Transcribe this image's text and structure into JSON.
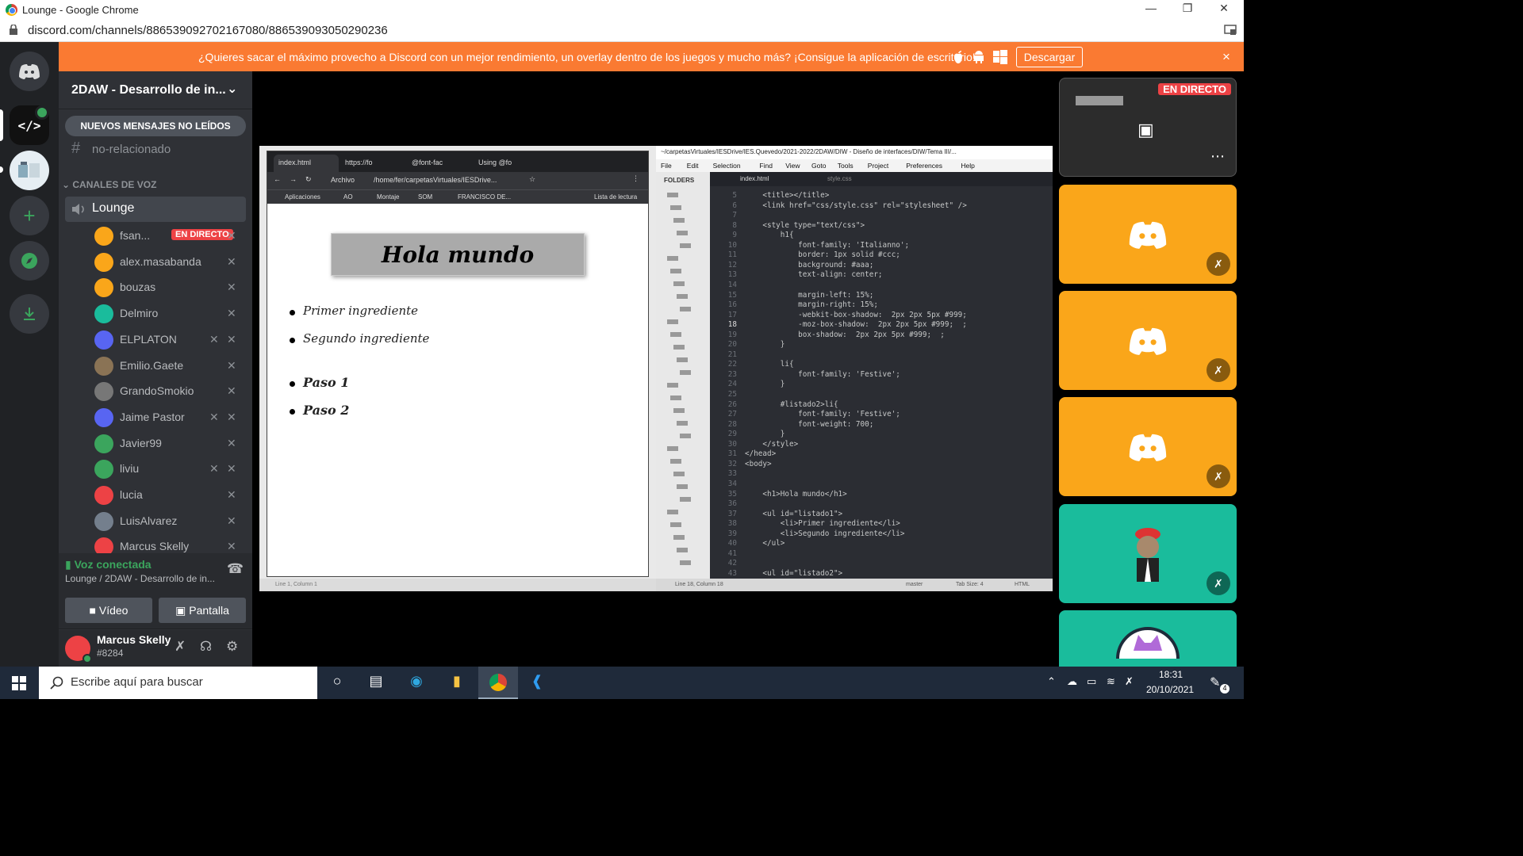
{
  "window": {
    "title": "Lounge - Google Chrome",
    "url": "discord.com/channels/886539092702167080/886539093050290236"
  },
  "banner": {
    "message": "¿Quieres sacar el máximo provecho a Discord con un mejor rendimiento, un overlay dentro de los juegos y mucho más? ¡Consigue la aplicación de escritorio!",
    "download_label": "Descargar",
    "close": "×"
  },
  "server": {
    "name": "2DAW - Desarrollo de in...",
    "unread_label": "NUEVOS MENSAJES NO LEÍDOS"
  },
  "channels": {
    "text_channel": "no-relacionado",
    "voice_category": "CANALES DE VOZ",
    "voice_channel": "Lounge"
  },
  "voice_users": [
    {
      "name": "fsan...",
      "live": "EN DIRECTO",
      "color": "#faa61a"
    },
    {
      "name": "alex.masabanda",
      "color": "#faa61a"
    },
    {
      "name": "bouzas",
      "color": "#faa61a"
    },
    {
      "name": "Delmiro",
      "color": "#1abc9c"
    },
    {
      "name": "ELPLATON",
      "color": "#5865f2"
    },
    {
      "name": "Emilio.Gaete",
      "color": "#8a7355"
    },
    {
      "name": "GrandoSmokio",
      "color": "#777"
    },
    {
      "name": "Jaime Pastor",
      "color": "#5865f2"
    },
    {
      "name": "Javier99",
      "color": "#3ba55d"
    },
    {
      "name": "liviu",
      "color": "#3ba55d"
    },
    {
      "name": "lucia",
      "color": "#ed4245"
    },
    {
      "name": "LuisAlvarez",
      "color": "#747f8d"
    },
    {
      "name": "Marcus Skelly",
      "color": "#ed4245"
    }
  ],
  "voice_panel": {
    "status": "Voz conectada",
    "location": "Lounge / 2DAW - Desarrollo de in...",
    "video_label": "Vídeo",
    "screen_label": "Pantalla"
  },
  "user": {
    "name": "Marcus Skelly",
    "tag": "#8284"
  },
  "browser": {
    "tabs": [
      "index.html",
      "https://fo",
      "@font-fac",
      "Using @fo"
    ],
    "address": "/home/fer/carpetasVirtuales/IESDrive...",
    "address_prefix": "Archivo",
    "bookmarks": [
      "Aplicaciones",
      "AO",
      "Montaje",
      "SOM",
      "FRANCISCO DE...",
      "Lista de lectura"
    ],
    "page": {
      "heading": "Hola mundo",
      "list1": [
        "Primer ingrediente",
        "Segundo ingrediente"
      ],
      "list2": [
        "Paso 1",
        "Paso 2"
      ]
    }
  },
  "editor": {
    "title": "~/carpetasVirtuales/IESDrive/IES.Quevedo/2021-2022/2DAW/DIW - Diseño de interfaces/DIW/Tema III/...",
    "menu": [
      "File",
      "Edit",
      "Selection",
      "Find",
      "View",
      "Goto",
      "Tools",
      "Project",
      "Preferences",
      "Help"
    ],
    "folders_label": "FOLDERS",
    "tabs": [
      "index.html",
      "style.css"
    ],
    "lines": [
      {
        "n": "5",
        "t": "    <title></title>"
      },
      {
        "n": "6",
        "t": "    <link href=\"css/style.css\" rel=\"stylesheet\" />"
      },
      {
        "n": "7",
        "t": ""
      },
      {
        "n": "8",
        "t": "    <style type=\"text/css\">"
      },
      {
        "n": "9",
        "t": "        h1{"
      },
      {
        "n": "10",
        "t": "            font-family: 'Italianno';"
      },
      {
        "n": "11",
        "t": "            border: 1px solid #ccc;"
      },
      {
        "n": "12",
        "t": "            background: #aaa;"
      },
      {
        "n": "13",
        "t": "            text-align: center;"
      },
      {
        "n": "14",
        "t": ""
      },
      {
        "n": "15",
        "t": "            margin-left: 15%;"
      },
      {
        "n": "16",
        "t": "            margin-right: 15%;"
      },
      {
        "n": "17",
        "t": "            -webkit-box-shadow:  2px 2px 5px #999;"
      },
      {
        "n": "18",
        "t": "            -moz-box-shadow:  2px 2px 5px #999;  ;"
      },
      {
        "n": "19",
        "t": "            box-shadow:  2px 2px 5px #999;  ;"
      },
      {
        "n": "20",
        "t": "        }"
      },
      {
        "n": "21",
        "t": ""
      },
      {
        "n": "22",
        "t": "        li{"
      },
      {
        "n": "23",
        "t": "            font-family: 'Festive';"
      },
      {
        "n": "24",
        "t": "        }"
      },
      {
        "n": "25",
        "t": ""
      },
      {
        "n": "26",
        "t": "        #listado2>li{"
      },
      {
        "n": "27",
        "t": "            font-family: 'Festive';"
      },
      {
        "n": "28",
        "t": "            font-weight: 700;"
      },
      {
        "n": "29",
        "t": "        }"
      },
      {
        "n": "30",
        "t": "    </style>"
      },
      {
        "n": "31",
        "t": "</head>"
      },
      {
        "n": "32",
        "t": "<body>"
      },
      {
        "n": "33",
        "t": ""
      },
      {
        "n": "34",
        "t": ""
      },
      {
        "n": "35",
        "t": "    <h1>Hola mundo</h1>"
      },
      {
        "n": "36",
        "t": ""
      },
      {
        "n": "37",
        "t": "    <ul id=\"listado1\">"
      },
      {
        "n": "38",
        "t": "        <li>Primer ingrediente</li>"
      },
      {
        "n": "39",
        "t": "        <li>Segundo ingrediente</li>"
      },
      {
        "n": "40",
        "t": "    </ul>"
      },
      {
        "n": "41",
        "t": ""
      },
      {
        "n": "42",
        "t": ""
      },
      {
        "n": "43",
        "t": "    <ul id=\"listado2\">"
      }
    ],
    "status_left": "Line 18, Column 18",
    "status_branch": "master",
    "status_tab": "Tab Size: 4",
    "status_syntax": "HTML"
  },
  "shared_status": "Line 1, Column 1",
  "tiles": {
    "live_badge": "EN DIRECTO"
  },
  "taskbar": {
    "search_placeholder": "Escribe aquí para buscar",
    "time": "18:31",
    "date": "20/10/2021",
    "notifications": "4"
  },
  "colors": {
    "banner": "#fa7a32",
    "tile_orange": "#faa61a",
    "tile_teal": "#1abc9c",
    "live": "#ed4245",
    "voice_green": "#3ba55d"
  }
}
